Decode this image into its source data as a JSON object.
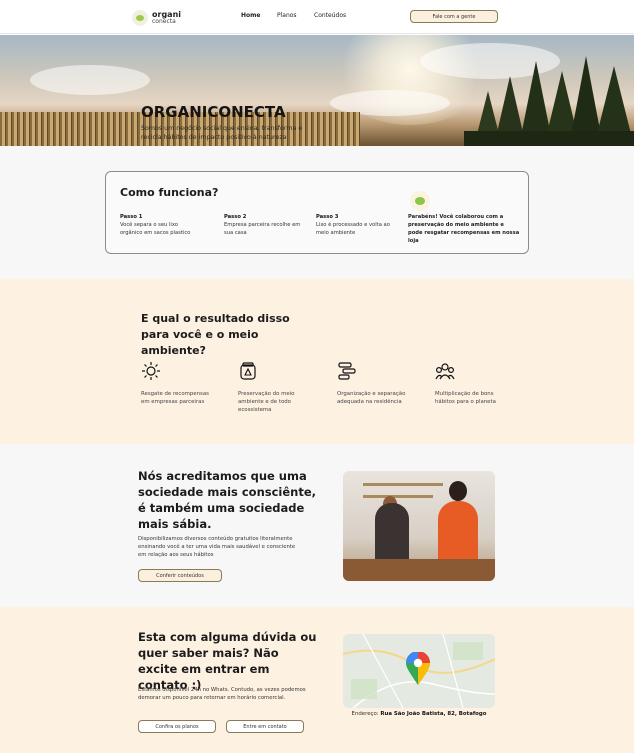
{
  "header": {
    "logo_line1": "organi",
    "logo_line2": "conecta",
    "nav": [
      "Home",
      "Planos",
      "Conteúdos"
    ],
    "cta": "Fale com a gente"
  },
  "hero": {
    "title": "ORGANICONECTA",
    "subtitle": "Somos um negócio social que ensina, transforma e recicla hábitos de impacto positivo à natureza"
  },
  "how": {
    "title": "Como funciona?",
    "steps": [
      {
        "label": "Passo 1",
        "text": "Você separa o seu lixo orgânico em sacos plastico"
      },
      {
        "label": "Passo 2",
        "text": "Empresa parceira recolhe em sua casa"
      },
      {
        "label": "Passo 3",
        "text": "Lixo é processado e volta ao meio ambiente"
      }
    ],
    "congrats": "Parabéns! Você colaborou com a preservação do meio ambiente e pode resgatar recompensas em nossa loja"
  },
  "results": {
    "title": "E qual o resultado disso para você e o meio ambiente?",
    "items": [
      {
        "icon": "sun-icon",
        "text": "Resgate de recompensas em empresas parceiras"
      },
      {
        "icon": "jar-icon",
        "text": "Preservação do meio ambiente e de todo ecossistema"
      },
      {
        "icon": "sort-icon",
        "text": "Organização e separação adequada na residência"
      },
      {
        "icon": "group-icon",
        "text": "Multiplicação de bons hábitos para o planeta"
      }
    ]
  },
  "belief": {
    "title": "Nós acreditamos que uma sociedade mais consciênte, é também uma sociedade mais sábia.",
    "text": "Disponibilizamos diversos conteúdo gratuitos literalmente ensinando você a ter uma vida mais saudável e consciente em relação aos seus hábitos",
    "button": "Conferir conteúdos"
  },
  "contact": {
    "title": "Esta com alguma dúvida ou quer saber mais? Não excite em entrar em contato :)",
    "text": "Estamos disponível 24h no Whats. Contudo, as vezes podemos demorar um pouco para retornar em horário comercial.",
    "button_plans": "Confira os planos",
    "button_contact": "Entre em contato",
    "address_label": "Endereço:",
    "address_value": "Rua São João Batista, 82, Botafogo"
  },
  "colors": {
    "accent_bg": "#fdf1e2",
    "neutral_bg": "#f7f7f7",
    "button_fill": "#fbf0de",
    "button_border": "#8a7a5a",
    "leaf_green": "#8fc44a"
  }
}
